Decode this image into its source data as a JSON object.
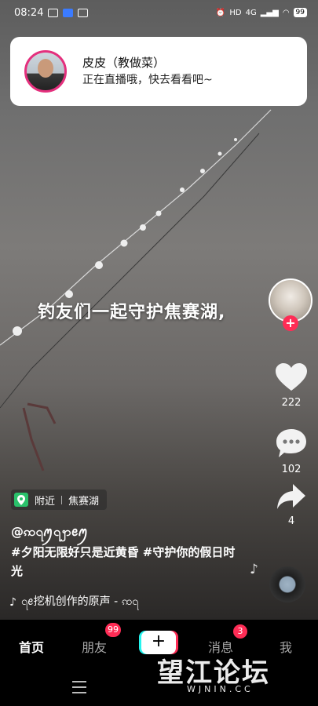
{
  "status_bar": {
    "time": "08:24",
    "network": "4G",
    "hd": "HD",
    "battery": "99"
  },
  "notification": {
    "name": "皮皮（教做菜）",
    "message": "正在直播哦，快去看看吧~"
  },
  "video": {
    "overlay_caption": "钓友们一起守护焦赛湖,"
  },
  "actions": {
    "like_count": "222",
    "comment_count": "102",
    "share_count": "4",
    "follow_symbol": "+"
  },
  "post": {
    "location_tag": "附近",
    "location_name": "焦赛湖",
    "author": "@ꩡ꩹ꪑ꩹ꩭꫀꪑ",
    "description": "#夕阳无限好只是近黄昏 #守护你的假日时光",
    "sound": "꩹ꫀ挖机创作的原声 - ꩡ꩹"
  },
  "nav": {
    "home": "首页",
    "friends": "朋友",
    "friends_badge": "99",
    "create": "+",
    "messages": "消息",
    "messages_badge": "3",
    "me": "我"
  },
  "watermark": {
    "main": "望江论坛",
    "sub": "WJNIN.CC"
  },
  "colors": {
    "accent": "#fe2c55",
    "cyan": "#25f4ee",
    "location_pin": "#2ac16b"
  }
}
